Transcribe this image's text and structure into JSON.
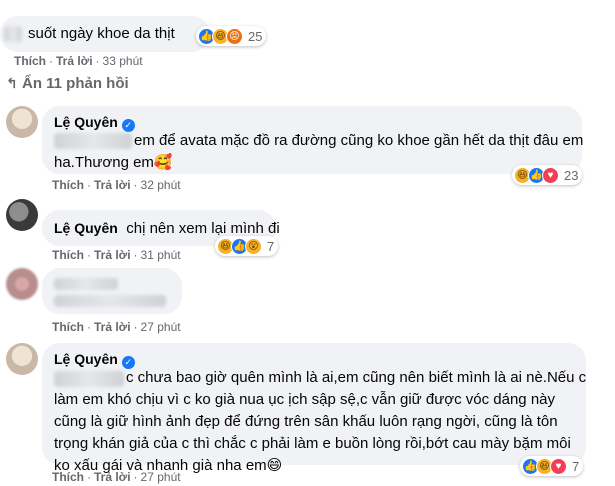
{
  "comments": [
    {
      "text": "suốt ngày khoe da thịt",
      "reactions": {
        "icons": [
          "like-icon",
          "haha-icon",
          "angry-icon"
        ],
        "count": "25"
      },
      "actions": {
        "like": "Thích",
        "reply": "Trả lời",
        "time": "33 phút"
      }
    },
    {
      "author": "Lệ Quyên",
      "line1": "em để avata mặc đồ ra đường cũng ko khoe gần hết da thịt đâu em",
      "line2": "ha.Thương em🥰",
      "reactions": {
        "icons": [
          "haha-icon",
          "like-icon",
          "heart-icon"
        ],
        "count": "23"
      },
      "actions": {
        "like": "Thích",
        "reply": "Trả lời",
        "time": "32 phút"
      }
    },
    {
      "author": "Lệ Quyên",
      "text": "chị nên xem lại mình đi",
      "reactions": {
        "icons": [
          "haha-icon",
          "like-icon",
          "wow-icon"
        ],
        "count": "7"
      },
      "actions": {
        "like": "Thích",
        "reply": "Trả lời",
        "time": "31 phút"
      }
    },
    {
      "actions": {
        "like": "Thích",
        "reply": "Trả lời",
        "time": "27 phút"
      }
    },
    {
      "author": "Lệ Quyên",
      "lines": [
        "c chưa bao giờ quên mình là ai,em cũng nên biết mình là ai nè.Nếu c",
        "làm em khó chịu vì c ko già nua ục ịch sập sệ,c vẫn giữ được vóc dáng này",
        "cũng là giữ hình ảnh đẹp để đứng trên sân khấu luôn rạng ngời, cũng là tôn",
        "trọng khán giả của c thì chắc c phải làm e buồn lòng rồi,bớt cau mày bặm môi",
        "ko xấu gái và nhanh già nha em😄"
      ],
      "reactions": {
        "icons": [
          "like-icon",
          "haha-icon",
          "heart-icon"
        ],
        "count": "7"
      },
      "actions": {
        "like": "Thích",
        "reply": "Trả lời",
        "time": "27 phút"
      }
    }
  ],
  "hide_replies": {
    "label": "Ẩn 11 phản hồi"
  }
}
